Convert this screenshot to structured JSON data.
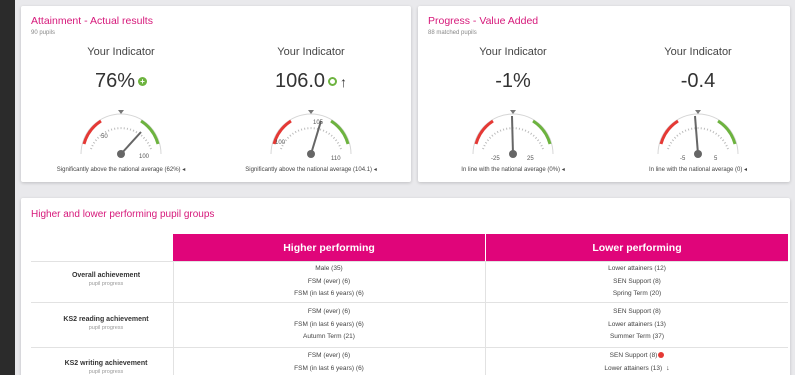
{
  "attainment": {
    "title": "Attainment - Actual results",
    "subtitle": "90 pupils",
    "indicators": [
      {
        "label": "Your Indicator",
        "value": "76%",
        "gauge_left": "50",
        "gauge_right": "100",
        "note": "Significantly above the national average (62%) ◂"
      },
      {
        "label": "Your Indicator",
        "value": "106.0",
        "gauge_left": "100",
        "gauge_top": "105",
        "gauge_right": "110",
        "note": "Significantly above the national average (104.1) ◂"
      }
    ]
  },
  "progress": {
    "title": "Progress - Value Added",
    "subtitle": "88 matched pupils",
    "indicators": [
      {
        "label": "Your Indicator",
        "value": "-1%",
        "gauge_left": "-25",
        "gauge_right": "25",
        "note": "In line with the national average (0%) ◂"
      },
      {
        "label": "Your Indicator",
        "value": "-0.4",
        "gauge_left": "-5",
        "gauge_right": "5",
        "note": "In line with the national average (0) ◂"
      }
    ]
  },
  "groups": {
    "title": "Higher and lower performing pupil groups",
    "higher_header": "Higher performing",
    "lower_header": "Lower performing",
    "rows": [
      {
        "label": "Overall achievement",
        "sub": "pupil progress",
        "higher": [
          "Male (35)",
          "FSM (ever) (6)",
          "FSM (in last 6 years) (6)"
        ],
        "lower": [
          "Lower attainers (12)",
          "SEN Support (8)",
          "Spring Term (20)"
        ]
      },
      {
        "label": "KS2 reading achievement",
        "sub": "pupil progress",
        "higher": [
          "FSM (ever) (6)",
          "FSM (in last 6 years) (6)",
          "Autumn Term (21)"
        ],
        "lower": [
          "SEN Support (8)",
          "Lower attainers (13)",
          "Summer Term (37)"
        ]
      },
      {
        "label": "KS2 writing achievement",
        "sub": "pupil progress",
        "higher": [
          "FSM (ever) (6)",
          "FSM (in last 6 years) (6)"
        ],
        "lower": [
          "SEN Support (8)",
          "Lower attainers (13)"
        ]
      }
    ]
  },
  "colors": {
    "accent": "#e0057a",
    "title": "#d6187a",
    "positive": "#6db33f",
    "negative": "#e53935"
  }
}
